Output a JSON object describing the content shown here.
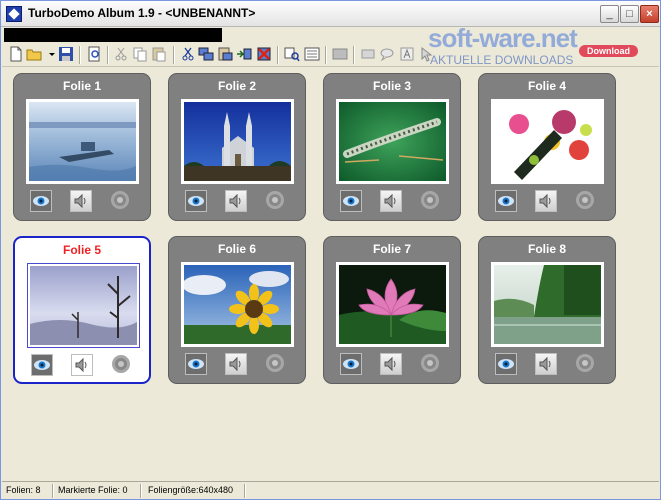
{
  "window": {
    "title": "TurboDemo Album 1.9 - <UNBENANNT>",
    "buttons": {
      "minimize": "_",
      "maximize": "□",
      "close": "×"
    }
  },
  "watermark": {
    "brand": "soft-ware.net",
    "badge": "Download",
    "tagline": "AKTUELLE DOWNLOADS"
  },
  "toolbar": {
    "icons": [
      "new-document-icon",
      "open-folder-icon",
      "save-icon",
      "preview-icon",
      "cut-icon",
      "copy-icon",
      "paste-icon",
      "cut-slide-icon",
      "copy-slide-icon",
      "paste-slide-icon",
      "insert-slide-icon",
      "delete-slide-icon",
      "find-icon",
      "properties-icon",
      "image-icon",
      "rect-icon",
      "speech-icon",
      "text-icon",
      "cursor-icon"
    ]
  },
  "slides": [
    {
      "label": "Folie 1",
      "image": "lake-boat",
      "selected": false
    },
    {
      "label": "Folie 2",
      "image": "church",
      "selected": false
    },
    {
      "label": "Folie 3",
      "image": "caterpillar",
      "selected": false
    },
    {
      "label": "Folie 4",
      "image": "bottle-flowers",
      "selected": false
    },
    {
      "label": "Folie 5",
      "image": "dead-trees",
      "selected": true
    },
    {
      "label": "Folie 6",
      "image": "sunflower",
      "selected": false
    },
    {
      "label": "Folie 7",
      "image": "lotus",
      "selected": false
    },
    {
      "label": "Folie 8",
      "image": "forest-lake",
      "selected": false
    }
  ],
  "status": {
    "slides": "Folien: 8",
    "marked": "Markierte Folie: 0",
    "size": "Foliengröße:640x480"
  }
}
